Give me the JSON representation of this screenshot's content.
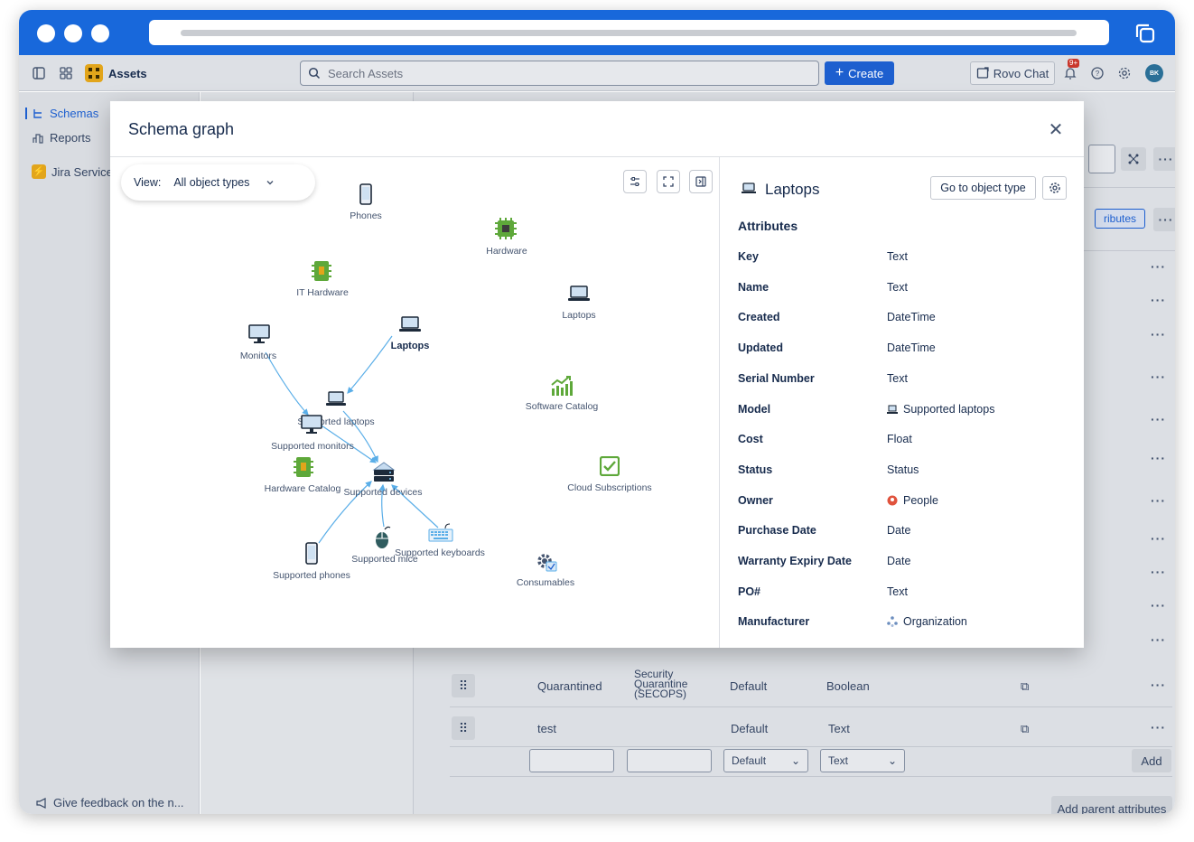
{
  "topnav": {
    "app_name": "Assets",
    "search_placeholder": "Search Assets",
    "create_label": "Create",
    "rovo_label": "Rovo Chat",
    "notif_count": "9+",
    "avatar_initials": "BK"
  },
  "sidebar": {
    "items": [
      {
        "label": "Schemas"
      },
      {
        "label": "Reports"
      },
      {
        "label": "Jira Service"
      }
    ],
    "feedback_label": "Give feedback on the n..."
  },
  "background": {
    "attributes_tab": "ributes",
    "rows": [
      {
        "name": "Quarantined",
        "ref": "Security Quarantine (SECOPS)",
        "visibility": "Default",
        "type": "Boolean"
      },
      {
        "name": "test",
        "ref": "",
        "visibility": "Default",
        "type": "Text"
      }
    ],
    "new_row": {
      "visibility": "Default",
      "type": "Text",
      "add_label": "Add"
    },
    "parent_button": "Add parent attributes"
  },
  "modal": {
    "title": "Schema graph",
    "view_label": "View:",
    "view_value": "All object types",
    "nodes": {
      "phones": "Phones",
      "hardware": "Hardware",
      "it_hardware": "IT Hardware",
      "laptops_far": "Laptops",
      "laptops_sel": "Laptops",
      "monitors": "Monitors",
      "software_catalog": "Software Catalog",
      "supported_laptops": "Supported laptops",
      "supported_monitors": "Supported monitors",
      "hardware_catalog": "Hardware Catalog",
      "supported_devices": "Supported devices",
      "cloud_subscriptions": "Cloud Subscriptions",
      "supported_mice": "Supported mice",
      "supported_keyboards": "Supported keyboards",
      "supported_phones": "Supported phones",
      "consumables": "Consumables"
    },
    "detail": {
      "title": "Laptops",
      "goto_label": "Go to object type",
      "attributes_heading": "Attributes",
      "attributes": [
        {
          "name": "Key",
          "type": "Text"
        },
        {
          "name": "Name",
          "type": "Text"
        },
        {
          "name": "Created",
          "type": "DateTime"
        },
        {
          "name": "Updated",
          "type": "DateTime"
        },
        {
          "name": "Serial Number",
          "type": "Text"
        },
        {
          "name": "Model",
          "type": "Supported laptops"
        },
        {
          "name": "Cost",
          "type": "Float"
        },
        {
          "name": "Status",
          "type": "Status"
        },
        {
          "name": "Owner",
          "type": "People"
        },
        {
          "name": "Purchase Date",
          "type": "Date"
        },
        {
          "name": "Warranty Expiry Date",
          "type": "Date"
        },
        {
          "name": "PO#",
          "type": "Text"
        },
        {
          "name": "Manufacturer",
          "type": "Organization"
        }
      ]
    }
  },
  "colors": {
    "brand": "#1868db",
    "edge": "#5aaee8",
    "chip_green": "#5ea83a"
  }
}
